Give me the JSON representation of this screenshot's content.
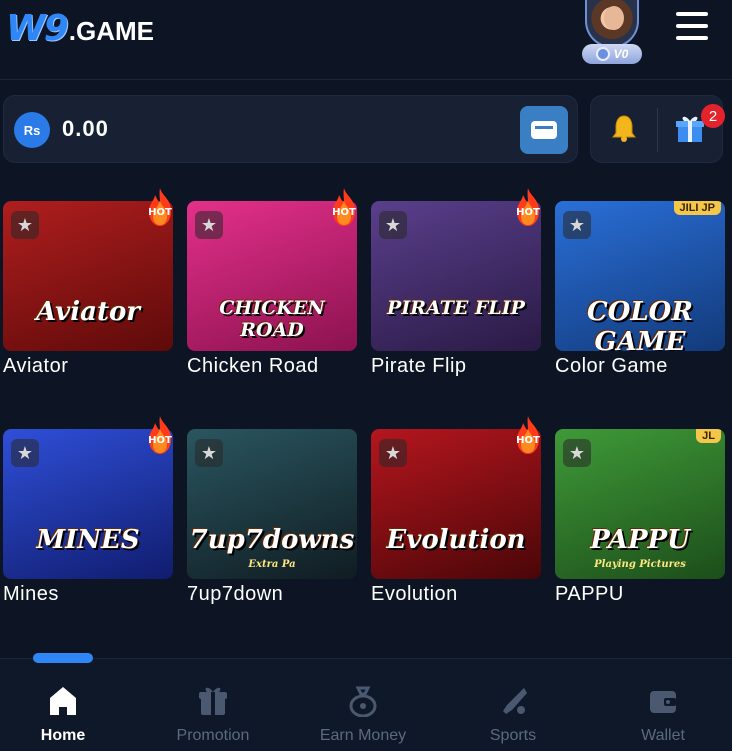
{
  "header": {
    "logo_primary": "W9",
    "logo_secondary": ".GAME",
    "vip_level": "V0",
    "menu_icon": "hamburger-icon"
  },
  "balance": {
    "currency_symbol": "Rs",
    "amount": "0.00",
    "wallet_icon": "card-icon"
  },
  "notifications": {
    "bell_icon": "bell-icon",
    "gift_icon": "gift-icon",
    "gift_count": "2"
  },
  "games": [
    {
      "name": "Aviator",
      "thumb_text": "Aviator",
      "hot": true,
      "hot_label": "HOT",
      "colors": [
        "#b01e1e",
        "#5e0a0a"
      ]
    },
    {
      "name": "Chicken Road",
      "thumb_text": "CHICKEN ROAD",
      "hot": true,
      "hot_label": "HOT",
      "colors": [
        "#e4308a",
        "#8c1250"
      ]
    },
    {
      "name": "Pirate Flip",
      "thumb_text": "PIRATE FLIP",
      "hot": true,
      "hot_label": "HOT",
      "colors": [
        "#5a3f8c",
        "#2a1a45"
      ]
    },
    {
      "name": "Color Game",
      "thumb_text": "COLOR GAME",
      "top_tag": "JILI JP",
      "hot": false,
      "colors": [
        "#2a6fd8",
        "#123a7a"
      ]
    },
    {
      "name": "Mines",
      "thumb_text": "MINES",
      "hot": true,
      "hot_label": "HOT",
      "colors": [
        "#2f4fd8",
        "#101c6e"
      ]
    },
    {
      "name": "7up7down",
      "thumb_text": "7up7downs",
      "sub_text": "Extra Pa",
      "hot": false,
      "colors": [
        "#2a5660",
        "#101c22"
      ]
    },
    {
      "name": "Evolution",
      "thumb_text": "Evolution",
      "hot": true,
      "hot_label": "HOT",
      "colors": [
        "#b5161e",
        "#4a0608"
      ]
    },
    {
      "name": "PAPPU",
      "thumb_text": "PAPPU",
      "sub_text": "Playing Pictures",
      "top_tag": "JL",
      "hot": false,
      "colors": [
        "#3f9a38",
        "#1c4e1a"
      ]
    }
  ],
  "nav": [
    {
      "label": "Home",
      "icon": "home-icon",
      "active": true
    },
    {
      "label": "Promotion",
      "icon": "gift-icon",
      "active": false
    },
    {
      "label": "Earn Money",
      "icon": "money-bag-icon",
      "active": false
    },
    {
      "label": "Sports",
      "icon": "sports-icon",
      "active": false
    },
    {
      "label": "Wallet",
      "icon": "wallet-icon",
      "active": false
    }
  ]
}
